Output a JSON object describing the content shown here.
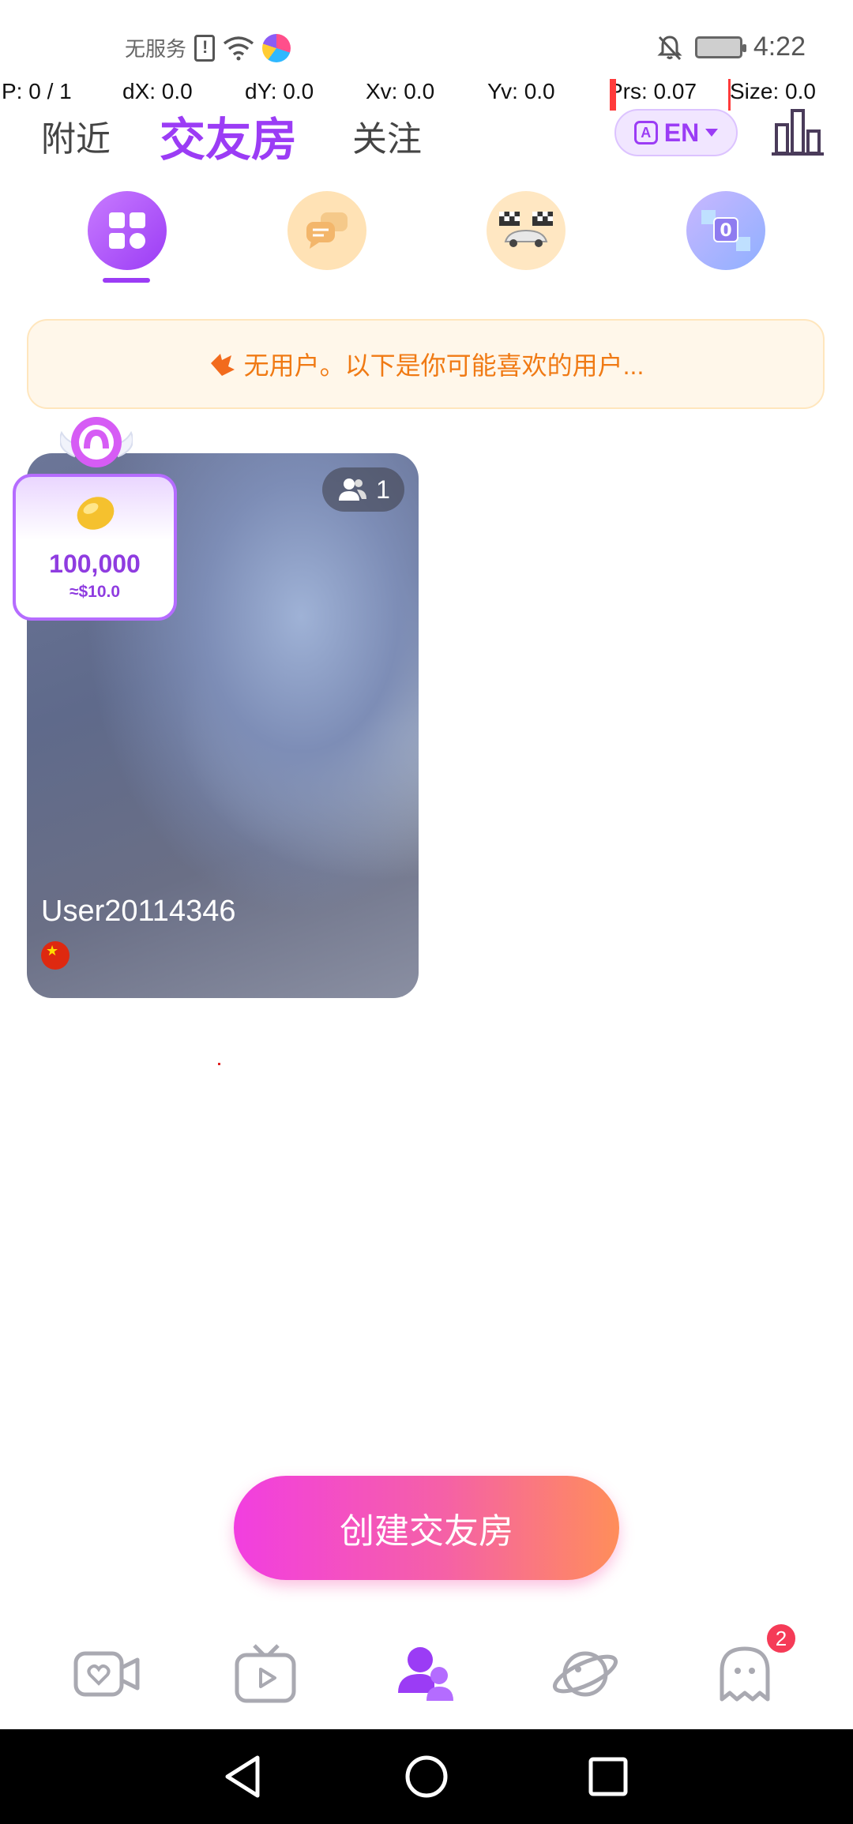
{
  "status_bar": {
    "carrier": "无服务",
    "time": "4:22"
  },
  "debug": {
    "pointer": "P: 0 / 1",
    "dx": "dX: 0.0",
    "dy": "dY: 0.0",
    "xv": "Xv: 0.0",
    "yv": "Yv: 0.0",
    "prs": "Prs: 0.07",
    "size": "Size: 0.0"
  },
  "top_nav": {
    "tabs": [
      {
        "label": "附近",
        "active": false
      },
      {
        "label": "交友房",
        "active": true
      },
      {
        "label": "关注",
        "active": false
      }
    ],
    "language": "EN"
  },
  "categories": [
    {
      "icon": "grid-icon",
      "selected": true
    },
    {
      "icon": "chat-bubbles-icon",
      "selected": false
    },
    {
      "icon": "racing-car-icon",
      "selected": false
    },
    {
      "icon": "number-blocks-icon",
      "selected": false
    }
  ],
  "notice": {
    "text": "无用户。以下是你可能喜欢的用户..."
  },
  "room": {
    "username": "User20114346",
    "member_count": "1",
    "country_flag": "china-flag-icon"
  },
  "reward": {
    "amount": "100,000",
    "usd": "≈$10.0"
  },
  "create_button": {
    "label": "创建交友房"
  },
  "bottom_tabs": [
    {
      "icon": "video-heart-icon",
      "active": false
    },
    {
      "icon": "tv-play-icon",
      "active": false
    },
    {
      "icon": "friends-room-icon",
      "active": true
    },
    {
      "icon": "planet-icon",
      "active": false
    },
    {
      "icon": "ghost-message-icon",
      "active": false
    }
  ],
  "message_badge": "2",
  "colors": {
    "accent": "#9b3cf5",
    "notice_text": "#f07a14",
    "create_gradient_start": "#f23ee0",
    "create_gradient_end": "#ff8e5a",
    "badge_red": "#f53b57"
  }
}
